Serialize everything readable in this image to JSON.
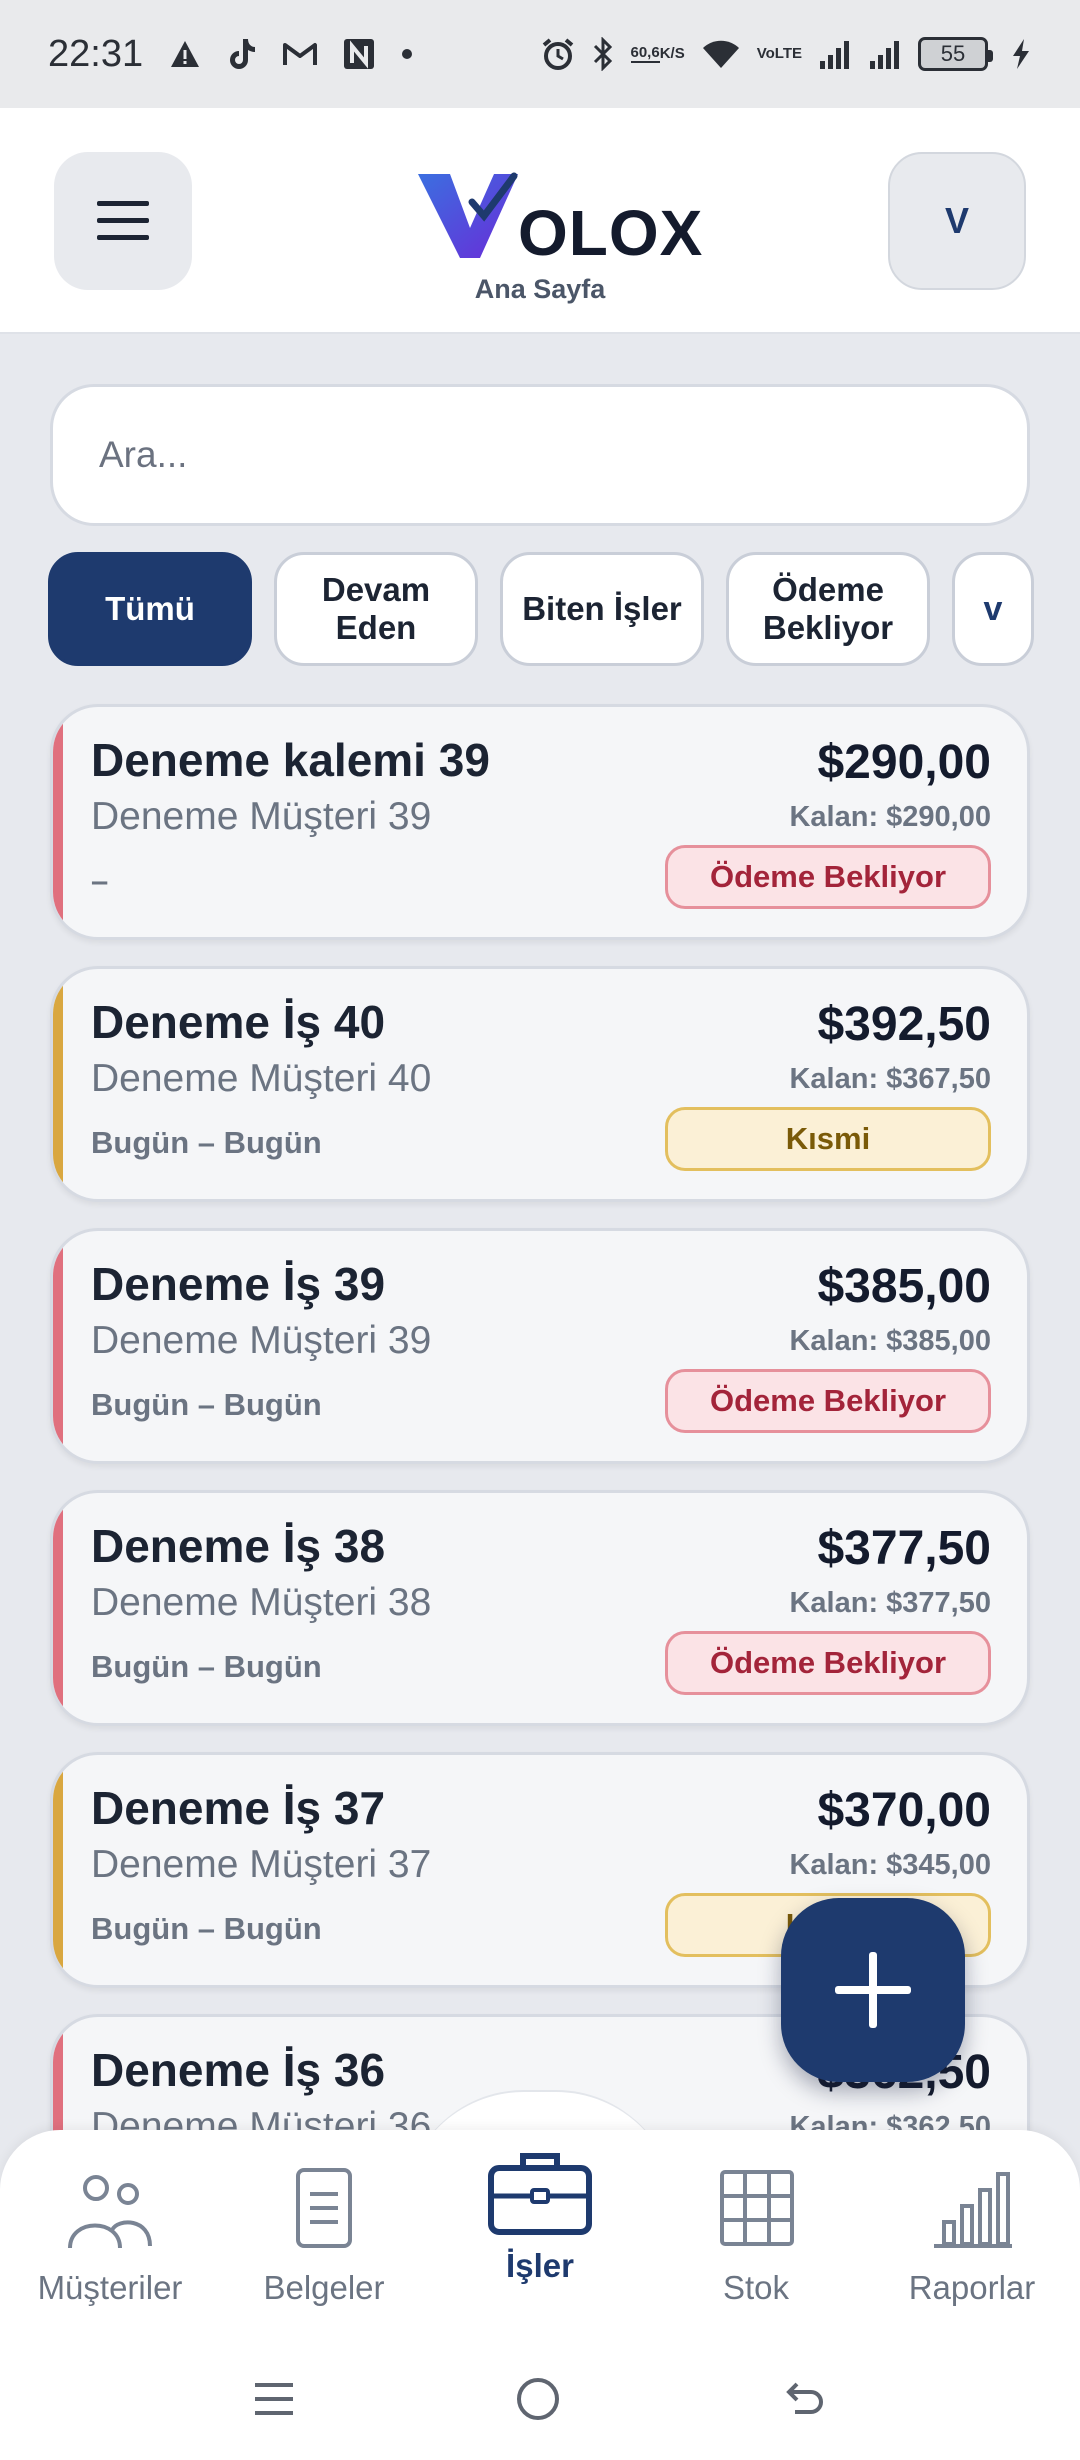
{
  "status_bar": {
    "time": "22:31",
    "network_speed_value": "60,6",
    "network_speed_unit": "K/S",
    "volte_top": "Vo",
    "volte_bottom": "LTE",
    "battery": "55"
  },
  "header": {
    "logo_text": "OLOX",
    "subtitle": "Ana Sayfa",
    "avatar_initial": "V"
  },
  "search": {
    "placeholder": "Ara..."
  },
  "filters": {
    "items": [
      {
        "label": "Tümü",
        "active": true
      },
      {
        "label": "Devam Eden",
        "active": false
      },
      {
        "label": "Biten İşler",
        "active": false
      },
      {
        "label": "Ödeme Bekliyor",
        "active": false
      }
    ],
    "more_label": "v"
  },
  "jobs": [
    {
      "title": "Deneme kalemi 39",
      "client": "Deneme Müşteri 39",
      "dates": "–",
      "amount": "$290,00",
      "remaining": "Kalan: $290,00",
      "status": "Ödeme Bekliyor",
      "status_color": "#e0707e"
    },
    {
      "title": "Deneme İş 40",
      "client": "Deneme Müşteri 40",
      "dates": "Bugün – Bugün",
      "amount": "$392,50",
      "remaining": "Kalan: $367,50",
      "status": "Kısmi",
      "status_color": "#d9a740"
    },
    {
      "title": "Deneme İş 39",
      "client": "Deneme Müşteri 39",
      "dates": "Bugün – Bugün",
      "amount": "$385,00",
      "remaining": "Kalan: $385,00",
      "status": "Ödeme Bekliyor",
      "status_color": "#e0707e"
    },
    {
      "title": "Deneme İş 38",
      "client": "Deneme Müşteri 38",
      "dates": "Bugün – Bugün",
      "amount": "$377,50",
      "remaining": "Kalan: $377,50",
      "status": "Ödeme Bekliyor",
      "status_color": "#e0707e"
    },
    {
      "title": "Deneme İş 37",
      "client": "Deneme Müşteri 37",
      "dates": "Bugün – Bugün",
      "amount": "$370,00",
      "remaining": "Kalan: $345,00",
      "status": "Kısmi",
      "status_color": "#d9a740"
    },
    {
      "title": "Deneme İş 36",
      "client": "Deneme Müşteri 36",
      "dates": "",
      "amount": "$362,50",
      "remaining": "Kalan: $362,50",
      "status": "",
      "status_color": "#e0707e"
    }
  ],
  "bottom_nav": {
    "items": [
      {
        "label": "Müşteriler",
        "icon": "users-icon",
        "active": false
      },
      {
        "label": "Belgeler",
        "icon": "document-icon",
        "active": false
      },
      {
        "label": "İşler",
        "icon": "briefcase-icon",
        "active": true
      },
      {
        "label": "Stok",
        "icon": "grid-icon",
        "active": false
      },
      {
        "label": "Raporlar",
        "icon": "bar-chart-icon",
        "active": false
      }
    ]
  },
  "colors": {
    "primary": "#1e3a6e",
    "awaiting_payment": "#e0707e",
    "partial": "#d9a740"
  }
}
